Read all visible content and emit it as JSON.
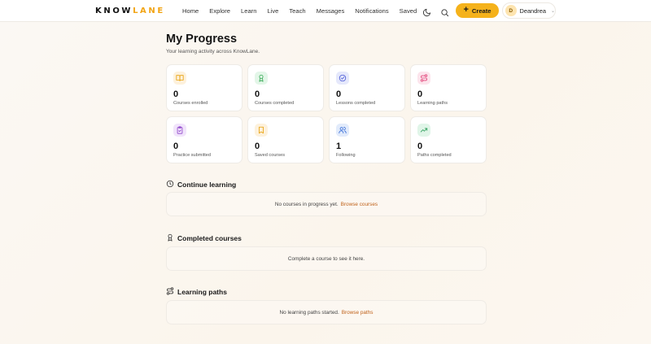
{
  "brand": {
    "part1": "KNOW",
    "part2": "LANE",
    "accent_color": "#f2a516"
  },
  "nav": {
    "links": [
      "Home",
      "Explore",
      "Learn",
      "Live",
      "Teach",
      "Messages",
      "Notifications",
      "Saved"
    ],
    "theme_icon": "moon-icon",
    "search_icon": "search-icon",
    "create_label": "Create",
    "user": {
      "initial": "D",
      "name": "Deandrea"
    }
  },
  "page": {
    "title": "My Progress",
    "subtitle": "Your learning activity across KnowLane."
  },
  "stats": [
    {
      "value": "0",
      "label": "Courses enrolled",
      "icon": "book-icon",
      "color": "#f5a623",
      "bg": "#fdf1dc"
    },
    {
      "value": "0",
      "label": "Courses completed",
      "icon": "award-icon",
      "color": "#34a853",
      "bg": "#e3f6e8"
    },
    {
      "value": "0",
      "label": "Lessons completed",
      "icon": "check-circle-icon",
      "color": "#4c5bd6",
      "bg": "#e5e8fb"
    },
    {
      "value": "0",
      "label": "Learning paths",
      "icon": "route-icon",
      "color": "#e2447a",
      "bg": "#fce4ec"
    },
    {
      "value": "0",
      "label": "Practice submitted",
      "icon": "clipboard-check-icon",
      "color": "#8e44c9",
      "bg": "#f1e4fb"
    },
    {
      "value": "0",
      "label": "Saved courses",
      "icon": "bookmark-icon",
      "color": "#e8a10a",
      "bg": "#fdf1dc"
    },
    {
      "value": "1",
      "label": "Following",
      "icon": "users-icon",
      "color": "#3a6fd8",
      "bg": "#e2ebfb"
    },
    {
      "value": "0",
      "label": "Paths completed",
      "icon": "trending-up-icon",
      "color": "#2e9e5b",
      "bg": "#e0f5e8"
    }
  ],
  "sections": {
    "continue": {
      "title": "Continue learning",
      "icon": "clock-icon",
      "empty_text": "No courses in progress yet.",
      "link": "Browse courses"
    },
    "completed": {
      "title": "Completed courses",
      "icon": "award-icon",
      "empty_text": "Complete a course to see it here."
    },
    "paths": {
      "title": "Learning paths",
      "icon": "route-icon",
      "empty_text": "No learning paths started.",
      "link": "Browse paths"
    }
  }
}
